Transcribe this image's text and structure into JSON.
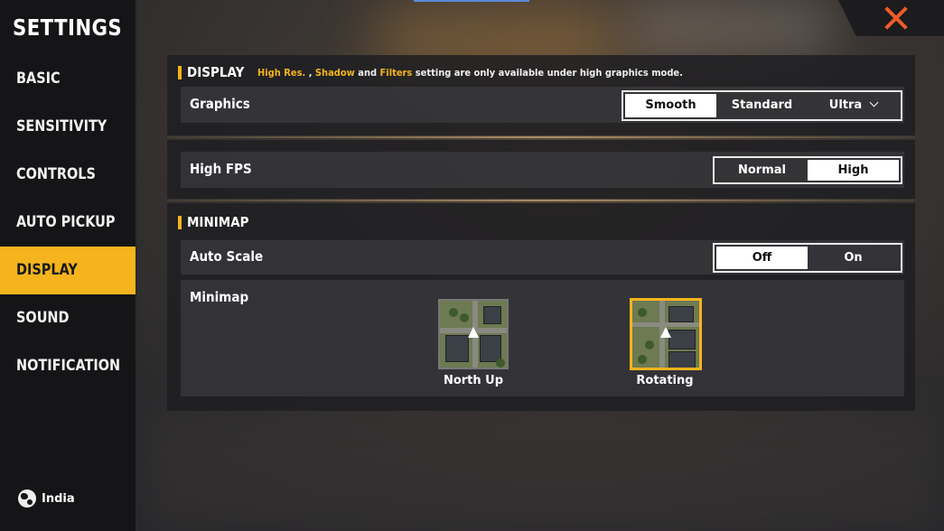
{
  "sidebar": {
    "title": "SETTINGS",
    "items": [
      {
        "label": "BASIC",
        "active": false
      },
      {
        "label": "SENSITIVITY",
        "active": false
      },
      {
        "label": "CONTROLS",
        "active": false
      },
      {
        "label": "AUTO PICKUP",
        "active": false
      },
      {
        "label": "DISPLAY",
        "active": true
      },
      {
        "label": "SOUND",
        "active": false
      },
      {
        "label": "NOTIFICATION",
        "active": false
      }
    ],
    "region": "India"
  },
  "display": {
    "title": "DISPLAY",
    "note": {
      "hl1": "High Res.",
      "sep1": " , ",
      "hl2": "Shadow",
      "sep2": " and ",
      "hl3": "Filters",
      "rest": " setting are only available under high graphics mode."
    },
    "graphics": {
      "label": "Graphics",
      "options": [
        "Smooth",
        "Standard",
        "Ultra"
      ],
      "selected": "Smooth"
    },
    "high_fps": {
      "label": "High FPS",
      "options": [
        "Normal",
        "High"
      ],
      "selected": "High"
    }
  },
  "minimap": {
    "title": "MINIMAP",
    "auto_scale": {
      "label": "Auto Scale",
      "options": [
        "Off",
        "On"
      ],
      "selected": "Off"
    },
    "minimap_label": "Minimap",
    "modes": [
      {
        "label": "North Up",
        "selected": false
      },
      {
        "label": "Rotating",
        "selected": true
      }
    ]
  },
  "colors": {
    "accent": "#f5b41d",
    "close": "#f05a28"
  }
}
